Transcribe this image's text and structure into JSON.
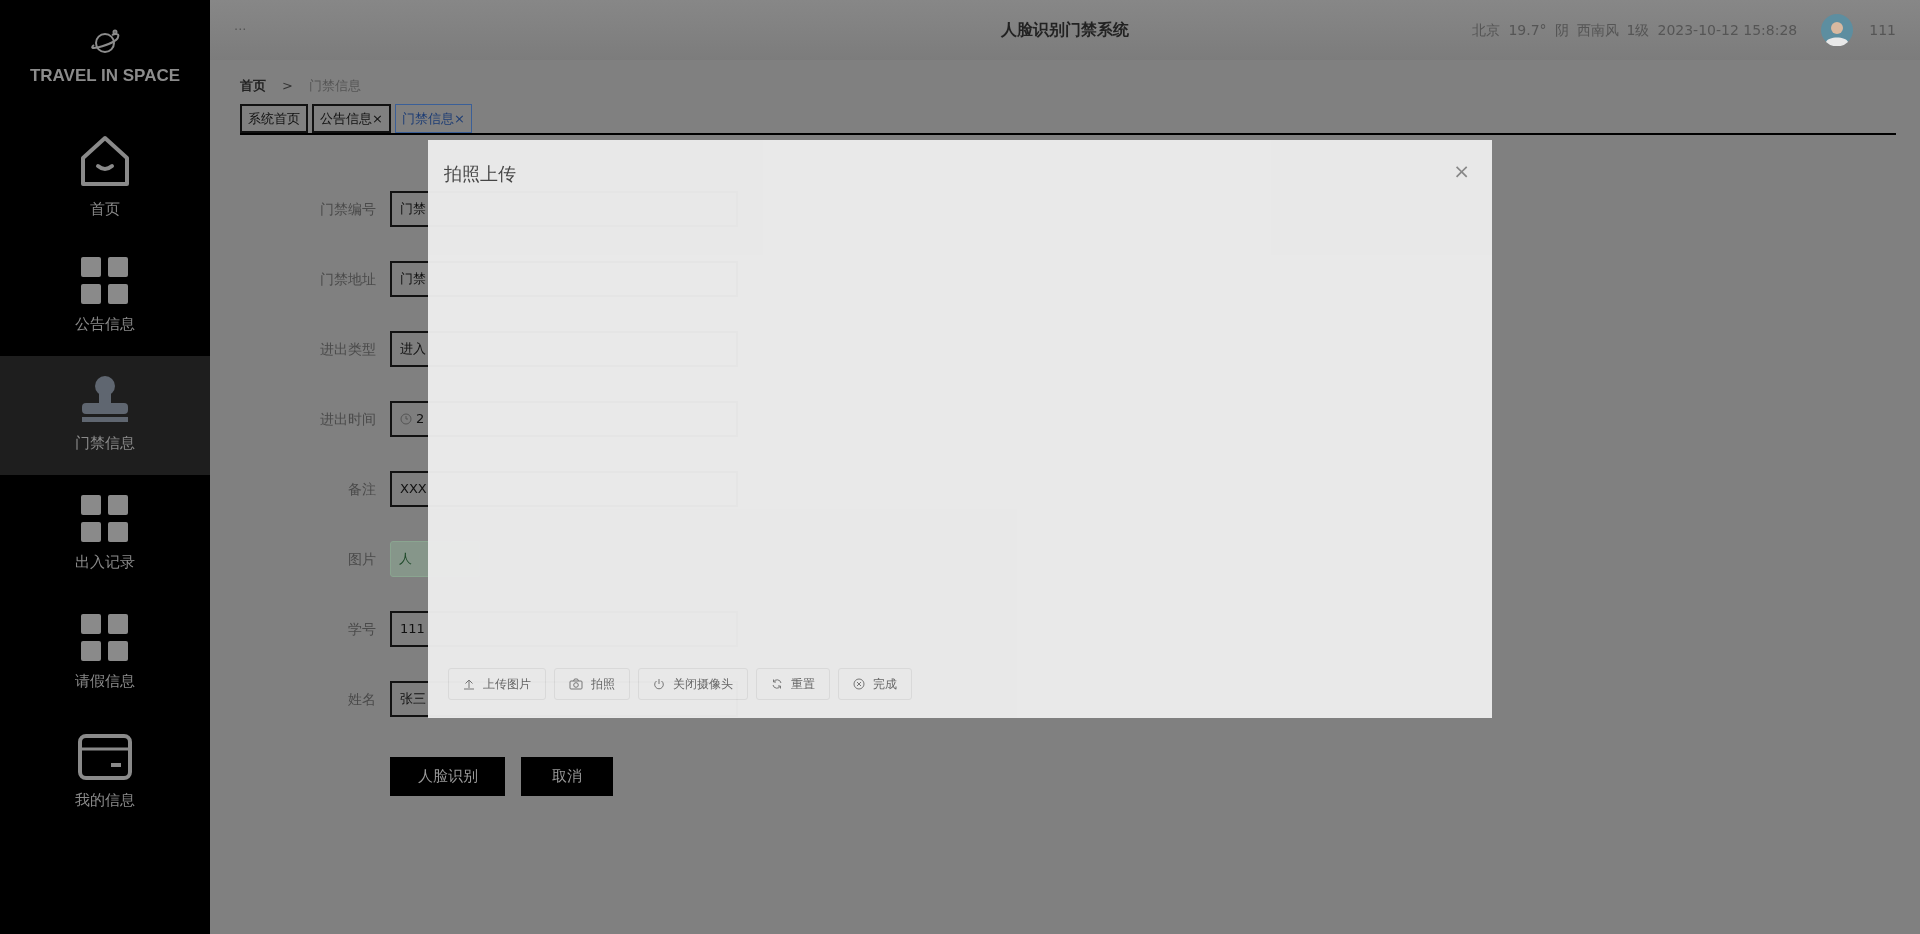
{
  "sidebar": {
    "logo": "TRAVEL IN SPACE",
    "items": [
      {
        "label": "首页",
        "kind": "home",
        "selected": false
      },
      {
        "label": "公告信息",
        "kind": "grid",
        "selected": false
      },
      {
        "label": "门禁信息",
        "kind": "stamp",
        "selected": true
      },
      {
        "label": "出入记录",
        "kind": "grid",
        "selected": false
      },
      {
        "label": "请假信息",
        "kind": "grid",
        "selected": false
      },
      {
        "label": "我的信息",
        "kind": "card",
        "selected": false
      }
    ]
  },
  "header": {
    "menu": "···",
    "title": "人脸识别门禁系统",
    "weather": [
      "北京",
      "19.7°",
      "阴",
      "西南风",
      "1级",
      "2023-10-12 15:8:28"
    ],
    "user": "111"
  },
  "breadcrumb": {
    "items": [
      "首页",
      "门禁信息"
    ],
    "separator": ">"
  },
  "tabs": [
    {
      "label": "系统首页",
      "selected": false
    },
    {
      "label": "公告信息",
      "close": "×",
      "selected": false
    },
    {
      "label": "门禁信息",
      "close": "×",
      "selected": true
    }
  ],
  "form": {
    "fields": [
      {
        "label": "门禁编号",
        "kind": "text",
        "value": "门禁"
      },
      {
        "label": "门禁地址",
        "kind": "text",
        "value": "门禁"
      },
      {
        "label": "进出类型",
        "kind": "text",
        "value": "进入"
      },
      {
        "label": "进出时间",
        "kind": "datetime",
        "value": "2"
      },
      {
        "label": "备注",
        "kind": "text",
        "value": "XXX"
      },
      {
        "label": "图片",
        "kind": "button",
        "value": "人"
      },
      {
        "label": "学号",
        "kind": "text",
        "value": "111"
      },
      {
        "label": "姓名",
        "kind": "text",
        "value": "张三"
      }
    ],
    "buttons": [
      "人脸识别",
      "取消"
    ]
  },
  "dialog": {
    "title": "拍照上传",
    "close": "×",
    "buttons": [
      {
        "label": "上传图片",
        "kind": "upload"
      },
      {
        "label": "拍照",
        "kind": "camera"
      },
      {
        "label": "关闭摄像头",
        "kind": "power"
      },
      {
        "label": "重置",
        "kind": "refresh"
      },
      {
        "label": "完成",
        "kind": "done"
      }
    ]
  }
}
